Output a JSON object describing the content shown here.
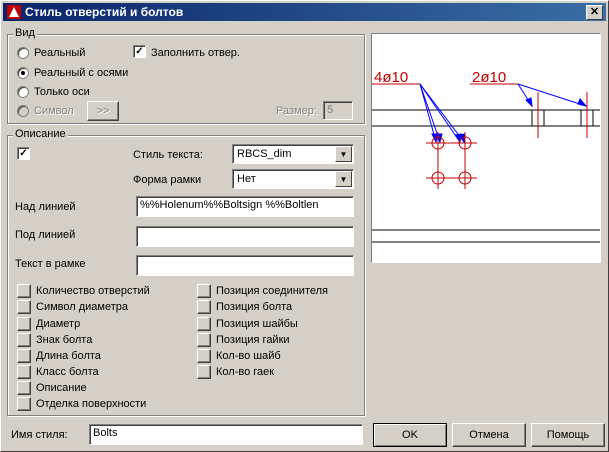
{
  "window": {
    "title": "Стиль отверстий и болтов",
    "close_label": "✕"
  },
  "view_group": {
    "legend": "Вид",
    "radio_real": "Реальный",
    "radio_real_axes": "Реальный с осями",
    "radio_axes_only": "Только оси",
    "radio_symbol": "Символ",
    "symbol_button": ">>",
    "fill_holes_label": "Заполнить отвер.",
    "size_label": "Размер:",
    "size_value": "5",
    "selected": "radio_real_axes",
    "fill_holes_checked": true
  },
  "description_group": {
    "legend": "Описание",
    "enabled_checked": true,
    "text_style_label": "Стиль текста:",
    "text_style_value": "RBCS_dim",
    "frame_shape_label": "Форма рамки",
    "frame_shape_value": "Нет",
    "above_line_label": "Над линией",
    "above_line_value": "%%Holenum%%Boltsign  %%Boltlen",
    "below_line_label": "Под линией",
    "below_line_value": "",
    "frame_text_label": "Текст в рамке",
    "frame_text_value": "",
    "left_buttons": [
      "Количество отверстий",
      "Символ диаметра",
      "Диаметр",
      "Знак болта",
      "Длина болта",
      "Класс болта",
      "Описание",
      "Отделка поверхности"
    ],
    "right_buttons": [
      "Позиция соединителя",
      "Позиция болта",
      "Позиция шайбы",
      "Позиция гайки",
      "Кол-во шайб",
      "Кол-во гаек"
    ]
  },
  "preview": {
    "label_left": "4ø10",
    "label_right": "2ø10",
    "accent_color": "#c00000",
    "arrow_color": "#0000ff"
  },
  "footer": {
    "style_name_label": "Имя стиля:",
    "style_name_value": "Bolts",
    "ok_label": "OK",
    "cancel_label": "Отмена",
    "help_label": "Помощь"
  }
}
